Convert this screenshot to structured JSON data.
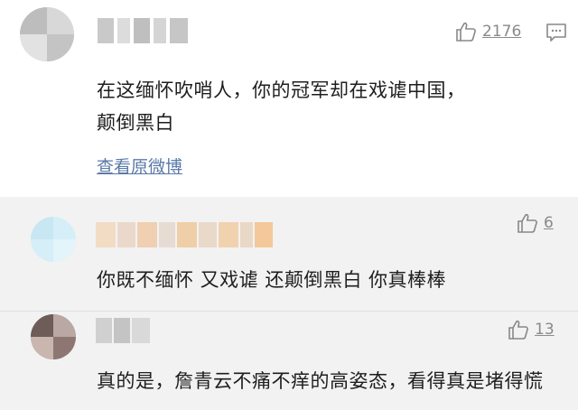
{
  "main": {
    "like_count": "2176",
    "text": "在这缅怀吹哨人，你的冠军却在戏谑中国，颠倒黑白",
    "view_original_label": "查看原微博"
  },
  "replies": [
    {
      "like_count": "6",
      "text": "你既不缅怀 又戏谑 还颠倒黑白 你真棒棒"
    },
    {
      "like_count": "13",
      "text": "真的是，詹青云不痛不痒的高姿态，看得真是堵得慌"
    }
  ],
  "icons": {
    "like": "thumbs-up-icon",
    "comment": "comment-icon"
  },
  "colors": {
    "link": "#5b79a8",
    "reply_background": "#f2f2f2",
    "icon_gray": "#888888"
  }
}
